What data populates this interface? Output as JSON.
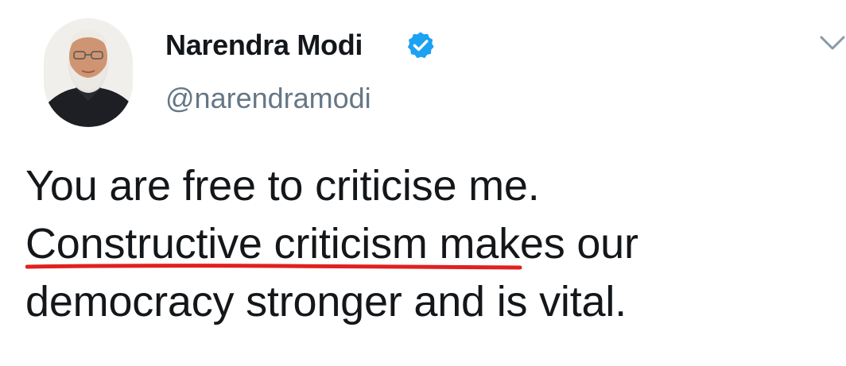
{
  "tweet": {
    "author": {
      "display_name": "Narendra Modi",
      "handle": "@narendramodi",
      "verified": true
    },
    "text_lines": [
      "You are free to criticise me.",
      "Constructive criticism ",
      "makes our",
      "democracy stronger and is vital."
    ],
    "highlight_color": "#e0211f",
    "verified_color": "#1da1f2"
  }
}
